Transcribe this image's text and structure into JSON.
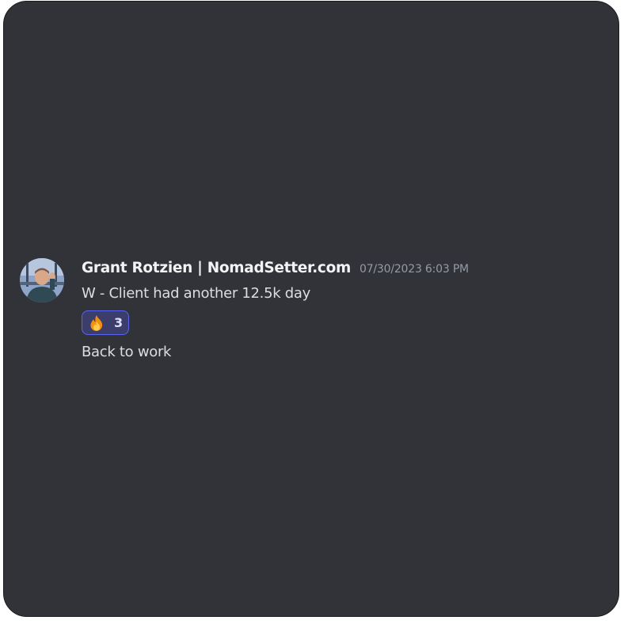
{
  "message": {
    "author": "Grant Rotzien | NomadSetter.com",
    "timestamp": "07/30/2023 6:03 PM",
    "text_line1": "W - Client had another 12.5k day",
    "reaction": {
      "emoji_icon": "fire-icon",
      "count": "3"
    },
    "text_line2": "Back to work"
  },
  "colors": {
    "background": "#313338",
    "username": "#f2f3f5",
    "timestamp": "#949ba4",
    "body_text": "#dbdee1",
    "reaction_border": "#5865f2",
    "reaction_bg": "#3b3e6a"
  }
}
